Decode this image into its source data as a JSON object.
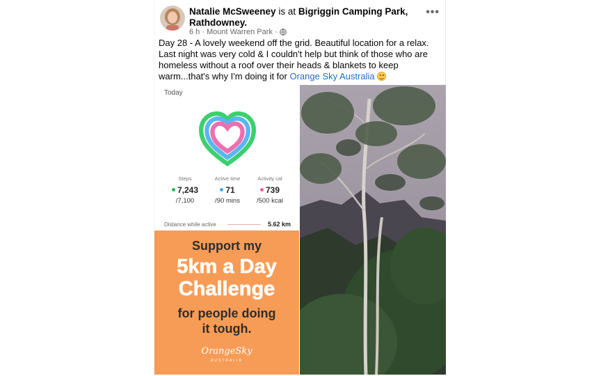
{
  "post": {
    "author": "Natalie McSweeney",
    "connector": " is at ",
    "place": "Bigriggin Camping Park, Rathdowney",
    "place_suffix": ".",
    "time": "6 h",
    "separator": "·",
    "location": "Mount Warren Park",
    "separator2": "·",
    "more_label": "•••",
    "text_before_link": "Day 28 - A lovely weekend off the grid. Beautiful location for a relax. Last night was very cold & I couldn't help but think of those who are homeless without a roof over their heads & blankets to keep warm...that's why I'm doing it for ",
    "link_text": "Orange Sky Australia",
    "icons": {
      "avatar": "avatar-photo",
      "more": "more-options-icon",
      "audience": "globe-icon",
      "emoji": "smiling-face-emoji"
    }
  },
  "health": {
    "today_label": "Today",
    "steps": {
      "label": "Steps",
      "value": "7,243",
      "goal": "/7,100",
      "color": "#1db954"
    },
    "active_time": {
      "label": "Active time",
      "value": "71",
      "goal": "/90 mins",
      "color": "#3fa9f5"
    },
    "activity_cal": {
      "label": "Activity cal",
      "value": "739",
      "goal": "/500 kcal",
      "color": "#ec5fa0"
    },
    "distance_label": "Distance while active",
    "distance_value": "5.62 km",
    "heart_colors": {
      "outer": "#3ccf6e",
      "middle": "#5ab6ef",
      "inner": "#ec6fb0"
    }
  },
  "promo": {
    "line1": "Support my",
    "line2": "5km a Day",
    "line3": "Challenge",
    "line4": "for people doing",
    "line5": "it tough.",
    "logo": "OrangeSky",
    "logo_sub": "AUSTRALIA",
    "background": "#f79c56"
  },
  "accent": "#1d6fc5"
}
